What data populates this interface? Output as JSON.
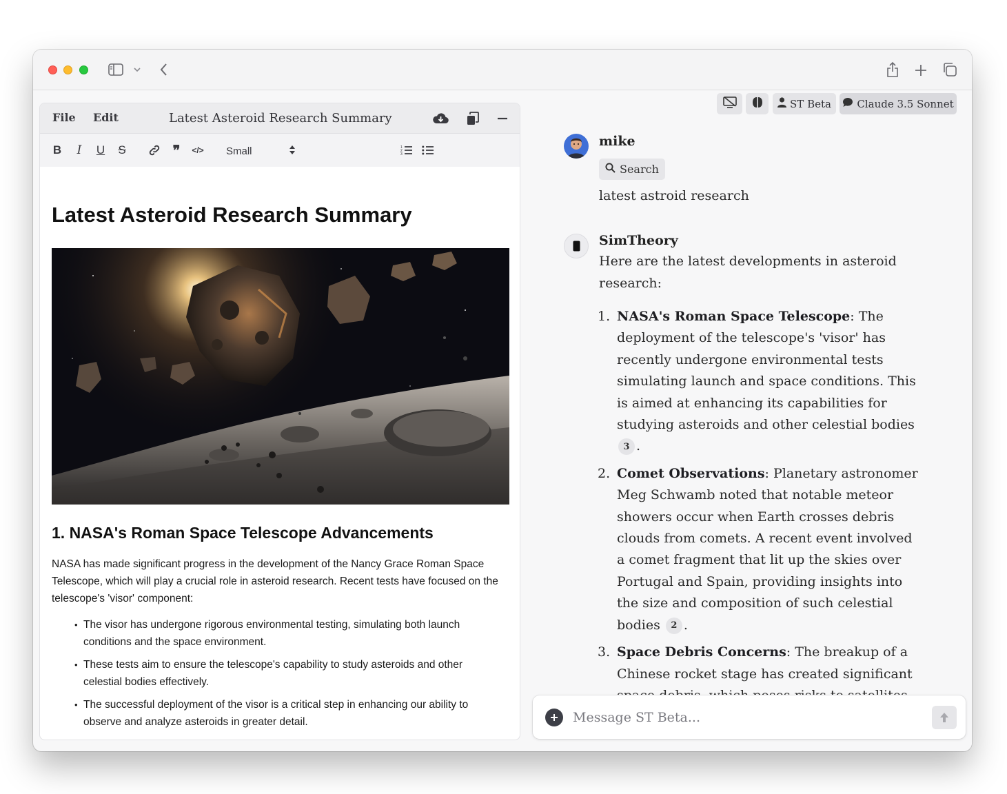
{
  "browser": {
    "icons": [
      "sidebar-toggle-icon",
      "chevron-down-icon",
      "back-icon",
      "share-icon",
      "new-tab-icon",
      "tab-overview-icon"
    ]
  },
  "editor": {
    "menu": {
      "file": "File",
      "edit": "Edit"
    },
    "title": "Latest Asteroid Research Summary",
    "header_icons": [
      "cloud-download-icon",
      "copy-icon",
      "minimize-icon"
    ],
    "format": {
      "bold": "B",
      "italic": "I",
      "underline": "U",
      "strikethrough": "S",
      "quote": "❞",
      "code": "</>",
      "size": "Small"
    },
    "content": {
      "h1": "Latest Asteroid Research Summary",
      "image_alt": "Asteroids over a cratered surface",
      "h2": "1. NASA's Roman Space Telescope Advancements",
      "paragraph": "NASA has made significant progress in the development of the Nancy Grace Roman Space Telescope, which will play a crucial role in asteroid research. Recent tests have focused on the telescope's 'visor' component:",
      "bullets": [
        "The visor has undergone rigorous environmental testing, simulating both launch conditions and the space environment.",
        "These tests aim to ensure the telescope's capability to study asteroids and other celestial bodies effectively.",
        "The successful deployment of the visor is a critical step in enhancing our ability to observe and analyze asteroids in greater detail."
      ]
    }
  },
  "chat": {
    "toolbar": {
      "profile": "ST Beta",
      "model": "Claude 3.5 Sonnet"
    },
    "user": {
      "name": "mike",
      "tool": "Search",
      "message": "latest astroid research"
    },
    "assistant": {
      "name": "SimTheory",
      "intro": "Here are the latest developments in asteroid research:",
      "items": [
        {
          "num": "1.",
          "title": "NASA's Roman Space Telescope",
          "text": ": The deployment of the telescope's 'visor' has recently undergone environmental tests simulating launch and space conditions. This is aimed at enhancing its capabilities for studying asteroids and other celestial bodies ",
          "cite": "3",
          "end": "."
        },
        {
          "num": "2.",
          "title": "Comet Observations",
          "text": ": Planetary astronomer Meg Schwamb noted that notable meteor showers occur when Earth crosses debris clouds from comets. A recent event involved a comet fragment that lit up the skies over Portugal and Spain, providing insights into the size and composition of such celestial bodies ",
          "cite": "2",
          "end": "."
        },
        {
          "num": "3.",
          "title": "Space Debris Concerns",
          "text": ": The breakup of a Chinese rocket stage has created significant space debris, which poses risks to satellites",
          "cite": "",
          "end": ""
        }
      ]
    },
    "composer": {
      "placeholder": "Message ST Beta..."
    }
  },
  "colors": {
    "traffic_red": "#ff5f57",
    "traffic_yellow": "#febc2e",
    "traffic_green": "#28c840",
    "chip_bg": "#e4e4e7",
    "composer_button": "#3d3f47"
  }
}
